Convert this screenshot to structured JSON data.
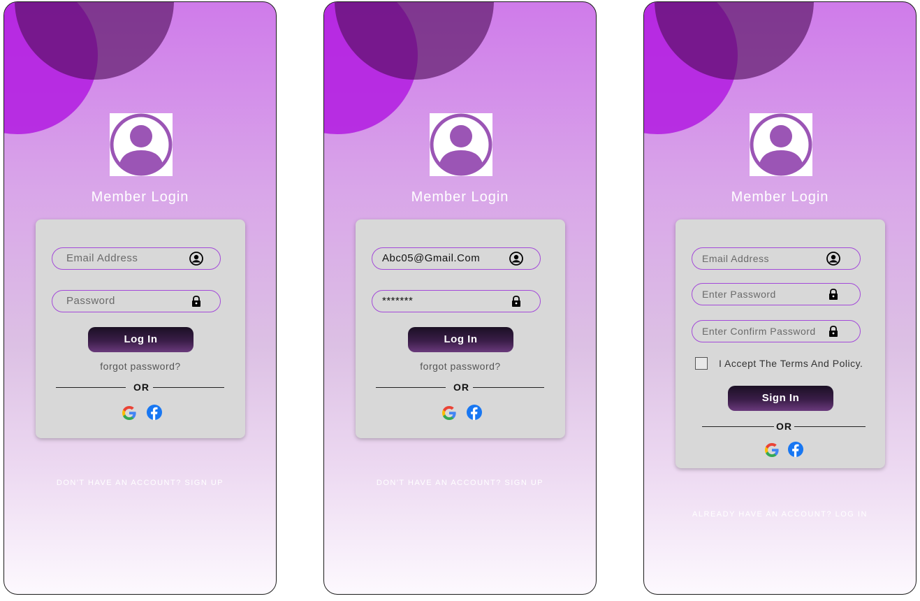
{
  "screens": [
    {
      "title": "Member Login",
      "email": {
        "placeholder": "Email Address"
      },
      "password": {
        "placeholder": "Password"
      },
      "login_button": "Log In",
      "forgot": "forgot password?",
      "or": "OR",
      "bottom": "DON'T HAVE AN ACCOUNT?  SIGN UP"
    },
    {
      "title": "Member Login",
      "email": {
        "value": "Abc05@Gmail.Com"
      },
      "password": {
        "value": "*******"
      },
      "login_button": "Log In",
      "forgot": "forgot password?",
      "or": "OR",
      "bottom": "DON'T HAVE AN ACCOUNT?  SIGN UP"
    },
    {
      "title": "Member Login",
      "email": {
        "placeholder": "Email Address"
      },
      "password": {
        "placeholder": "Enter Password"
      },
      "confirm_password": {
        "placeholder": "Enter Confirm Password"
      },
      "accept_terms": "I Accept The Terms And Policy.",
      "signin_button": "Sign In",
      "or": "OR",
      "bottom": "ALREADY HAVE AN ACCOUNT?  LOG IN"
    }
  ],
  "icons": {
    "avatar": "user-avatar-icon",
    "email": "user-circle-icon",
    "password": "lock-icon",
    "google": "google-icon",
    "facebook": "facebook-icon"
  },
  "colors": {
    "accent": "#a349d9",
    "button_dark": "#1b1024",
    "card": "#d8d8d8",
    "blob_magenta": "#b31fe0",
    "blob_dark": "#4f0d58"
  }
}
